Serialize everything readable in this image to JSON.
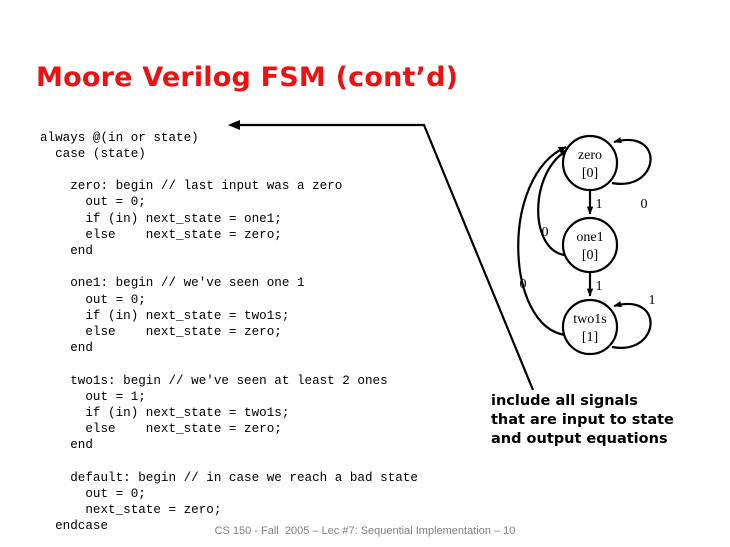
{
  "slide": {
    "title": "Moore Verilog FSM (cont’d)",
    "title_color": "#ee1111",
    "footer": "CS 150 - Fall  2005 – Lec #7: Sequential Implementation – 10",
    "footer_color": "#7f7f7f",
    "background": "#ffffff"
  },
  "code": {
    "language": "verilog",
    "text": "always @(in or state)\n  case (state)\n\n    zero: begin // last input was a zero\n      out = 0;\n      if (in) next_state = one1;\n      else    next_state = zero;\n    end\n\n    one1: begin // we've seen one 1\n      out = 0;\n      if (in) next_state = two1s;\n      else    next_state = zero;\n    end\n\n    two1s: begin // we've seen at least 2 ones\n      out = 1;\n      if (in) next_state = two1s;\n      else    next_state = zero;\n    end\n\n    default: begin // in case we reach a bad state\n      out = 0;\n      next_state = zero;\n  endcase",
    "lines": [
      "always @(in or state)",
      "  case (state)",
      "",
      "    zero: begin // last input was a zero",
      "      out = 0;",
      "      if (in) next_state = one1;",
      "      else    next_state = zero;",
      "    end",
      "",
      "    one1: begin // we've seen one 1",
      "      out = 0;",
      "      if (in) next_state = two1s;",
      "      else    next_state = zero;",
      "    end",
      "",
      "    two1s: begin // we've seen at least 2 ones",
      "      out = 1;",
      "      if (in) next_state = two1s;",
      "      else    next_state = zero;",
      "    end",
      "",
      "    default: begin // in case we reach a bad state",
      "      out = 0;",
      "      next_state = zero;",
      "  endcase"
    ]
  },
  "annotation": {
    "text": "include all signals\nthat are input to state\nand output equations",
    "color": "#000000"
  },
  "state_diagram": {
    "states": [
      {
        "name": "zero",
        "output": "[0]"
      },
      {
        "name": "one1",
        "output": "[0]"
      },
      {
        "name": "two1s",
        "output": "[1]"
      }
    ],
    "transitions": [
      {
        "from": "zero",
        "to": "zero",
        "label": "0"
      },
      {
        "from": "zero",
        "to": "one1",
        "label": "1"
      },
      {
        "from": "one1",
        "to": "zero",
        "label": "0"
      },
      {
        "from": "one1",
        "to": "two1s",
        "label": "1"
      },
      {
        "from": "two1s",
        "to": "zero",
        "label": "0"
      },
      {
        "from": "two1s",
        "to": "two1s",
        "label": "1"
      }
    ],
    "labels": {
      "zero_name": "zero",
      "zero_out": "[0]",
      "one1_name": "one1",
      "one1_out": "[0]",
      "two1s_name": "two1s",
      "two1s_out": "[1]",
      "zero_self": "0",
      "zero_to_one1": "1",
      "one1_to_zero": "0",
      "one1_to_two1s": "1",
      "two1s_to_zero": "0",
      "two1s_self": "1"
    }
  }
}
